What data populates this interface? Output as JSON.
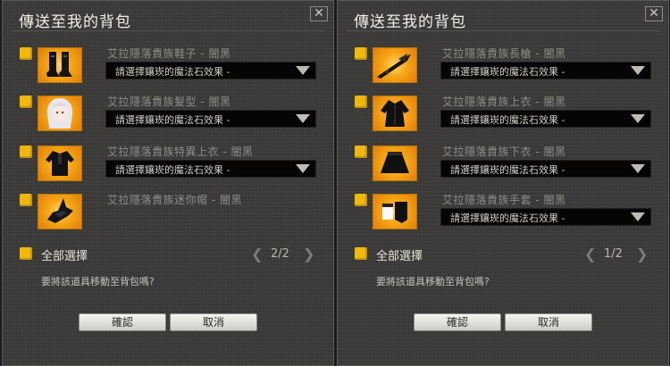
{
  "left": {
    "title": "傳送至我的背包",
    "close_glyph": "✕",
    "items": [
      {
        "name": "艾拉隱落貴族鞋子 - 闇黑",
        "select": "請選擇鑲崁的魔法石效果 -",
        "icon": "boots-icon"
      },
      {
        "name": "艾拉隱落貴族髮型 - 闇黑",
        "select": "請選擇鑲崁的魔法石效果 -",
        "icon": "hair-icon"
      },
      {
        "name": "艾拉隱落貴族特異上衣 - 闇黑",
        "select": "請選擇鑲崁的魔法石效果 -",
        "icon": "top-icon"
      },
      {
        "name": "艾拉隱落貴族迷你帽 - 闇黑",
        "icon": "hat-icon"
      }
    ],
    "select_all": "全部選擇",
    "page": "2/2",
    "prompt": "要將該道具移動至背包嗎?",
    "ok": "確認",
    "cancel": "取消"
  },
  "right": {
    "title": "傳送至我的背包",
    "close_glyph": "✕",
    "items": [
      {
        "name": "艾拉隱落貴族長槍 - 闇黑",
        "select": "請選擇鑲崁的魔法石效果 -",
        "icon": "spear-icon"
      },
      {
        "name": "艾拉隱落貴族上衣 - 闇黑",
        "select": "請選擇鑲崁的魔法石效果 -",
        "icon": "coat-icon"
      },
      {
        "name": "艾拉隱落貴族下衣 - 闇黑",
        "select": "請選擇鑲崁的魔法石效果 -",
        "icon": "skirt-icon"
      },
      {
        "name": "艾拉隱落貴族手套 - 闇黑",
        "select": "請選擇鑲崁的魔法石效果 -",
        "icon": "gloves-icon"
      }
    ],
    "select_all": "全部選擇",
    "page": "1/2",
    "prompt": "要將該道具移動至背包嗎?",
    "ok": "確認",
    "cancel": "取消"
  },
  "colors": {
    "accent": "#f2b70d",
    "panel": "#3b3a38",
    "select_bg": "#050505"
  }
}
